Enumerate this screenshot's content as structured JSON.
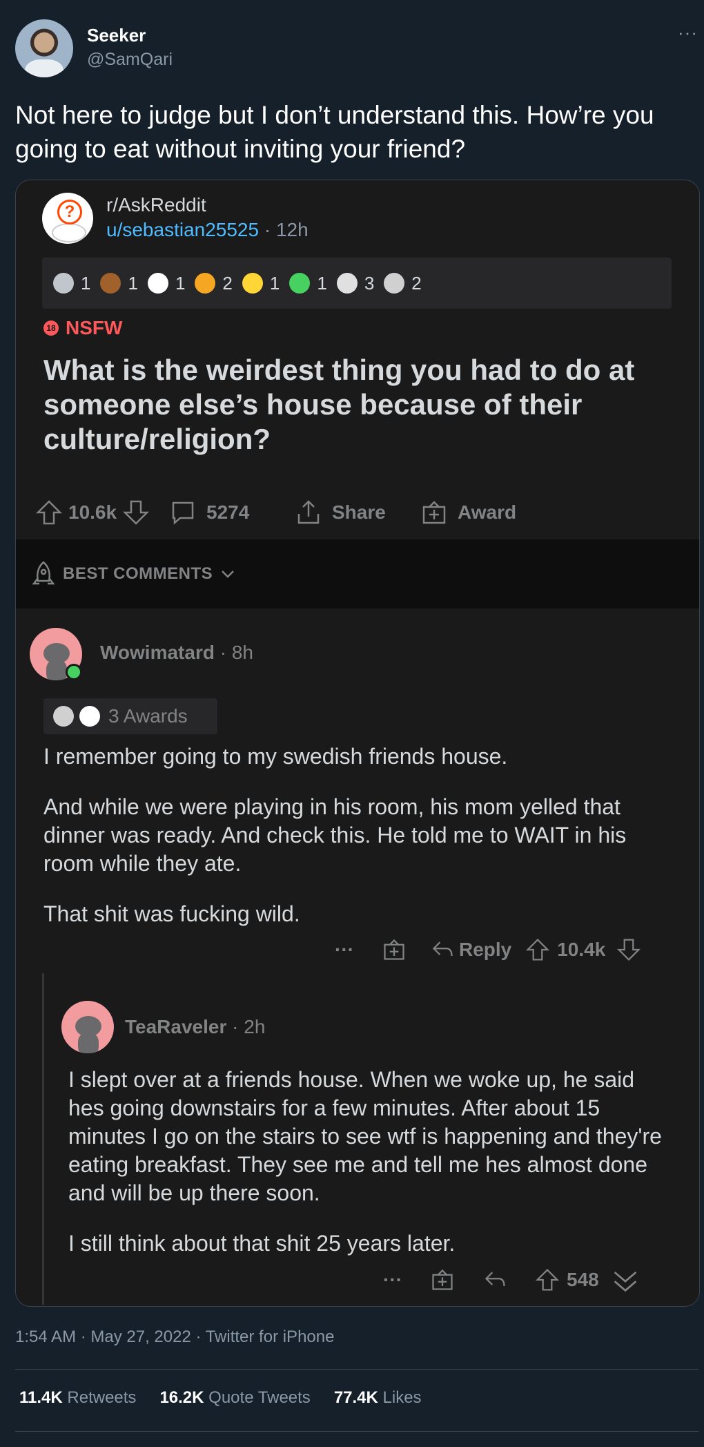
{
  "tweet": {
    "name": "Seeker",
    "handle": "@SamQari",
    "more": "···",
    "text": "Not here to judge but I don’t understand this. How’re you going to eat without inviting your friend?",
    "footer": "1:54 AM · May 27, 2022 · Twitter for iPhone",
    "stats": {
      "retweets_count": "11.4K",
      "retweets_label": "Retweets",
      "quotes_count": "16.2K",
      "quotes_label": "Quote Tweets",
      "likes_count": "77.4K",
      "likes_label": "Likes"
    }
  },
  "post": {
    "subreddit": "r/AskReddit",
    "author": "u/sebastian25525",
    "time": "12h",
    "awards": [
      {
        "icon": "silver-award",
        "count": "1",
        "color": "#c0c6cc"
      },
      {
        "icon": "bear-award",
        "count": "1",
        "color": "#a0612a"
      },
      {
        "icon": "snoo-award",
        "count": "1",
        "color": "#ffffff"
      },
      {
        "icon": "heart-eyes-award",
        "count": "2",
        "color": "#f5a623"
      },
      {
        "icon": "party-award",
        "count": "1",
        "color": "#ffd635"
      },
      {
        "icon": "snake-award",
        "count": "1",
        "color": "#46d160"
      },
      {
        "icon": "s-coin-award",
        "count": "3",
        "color": "#e0e0e0"
      },
      {
        "icon": "handshake-award",
        "count": "2",
        "color": "#d0d0d0"
      }
    ],
    "nsfw_badge": "18",
    "nsfw": "NSFW",
    "title": "What is the weirdest thing you had to do at someone else’s house because of their culture/religion?",
    "votes": "10.6k",
    "comments": "5274",
    "share": "Share",
    "award": "Award",
    "sort_label": "BEST COMMENTS"
  },
  "comment1": {
    "user": "Wowimatard",
    "time": "8h",
    "awards_label": "3 Awards",
    "paragraphs": [
      "I remember going to my swedish friends house.",
      "And while we were playing in his room, his mom yelled that dinner was ready. And check this. He told me to WAIT in his room while they ate.",
      "That shit was fucking wild."
    ],
    "more": "···",
    "reply": "Reply",
    "votes": "10.4k"
  },
  "comment2": {
    "user": "TeaRaveler",
    "time": "2h",
    "paragraphs": [
      "I slept over at a friends house. When we woke up, he said hes going downstairs for a few minutes. After about 15 minutes I go on the stairs to see wtf is happening and they're eating breakfast. They see me and tell me hes almost done and will be up there soon.",
      "I still think about that shit 25 years later."
    ],
    "more": "···",
    "votes": "548"
  }
}
